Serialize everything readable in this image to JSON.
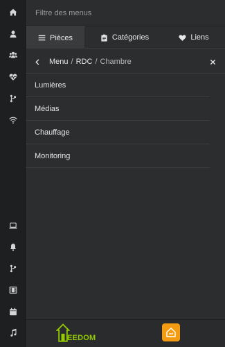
{
  "search": {
    "placeholder": "Filtre des menus"
  },
  "tabs": [
    {
      "label": "Pièces",
      "icon": "list-icon",
      "active": true
    },
    {
      "label": "Catégories",
      "icon": "clipboard-icon",
      "active": false
    },
    {
      "label": "Liens",
      "icon": "heart-icon",
      "active": false
    }
  ],
  "breadcrumb": {
    "items": [
      "Menu",
      "RDC",
      "Chambre"
    ],
    "separator": "/"
  },
  "menu_items": [
    "Lumières",
    "Médias",
    "Chauffage",
    "Monitoring"
  ],
  "rail_icons_top": [
    "home-icon",
    "user-icon",
    "users-icon",
    "heartbeat-icon",
    "branch-icon",
    "wifi-icon"
  ],
  "rail_icons_bottom": [
    "laptop-icon",
    "bell-icon",
    "branch-icon",
    "film-icon",
    "calendar-icon",
    "music-icon"
  ],
  "logo": {
    "text_first": "E",
    "text_rest": "EDOM",
    "color": "#94ca02"
  },
  "colors": {
    "accent": "#f39c12",
    "background": "#2c2d2f",
    "rail": "#1e1f21"
  }
}
